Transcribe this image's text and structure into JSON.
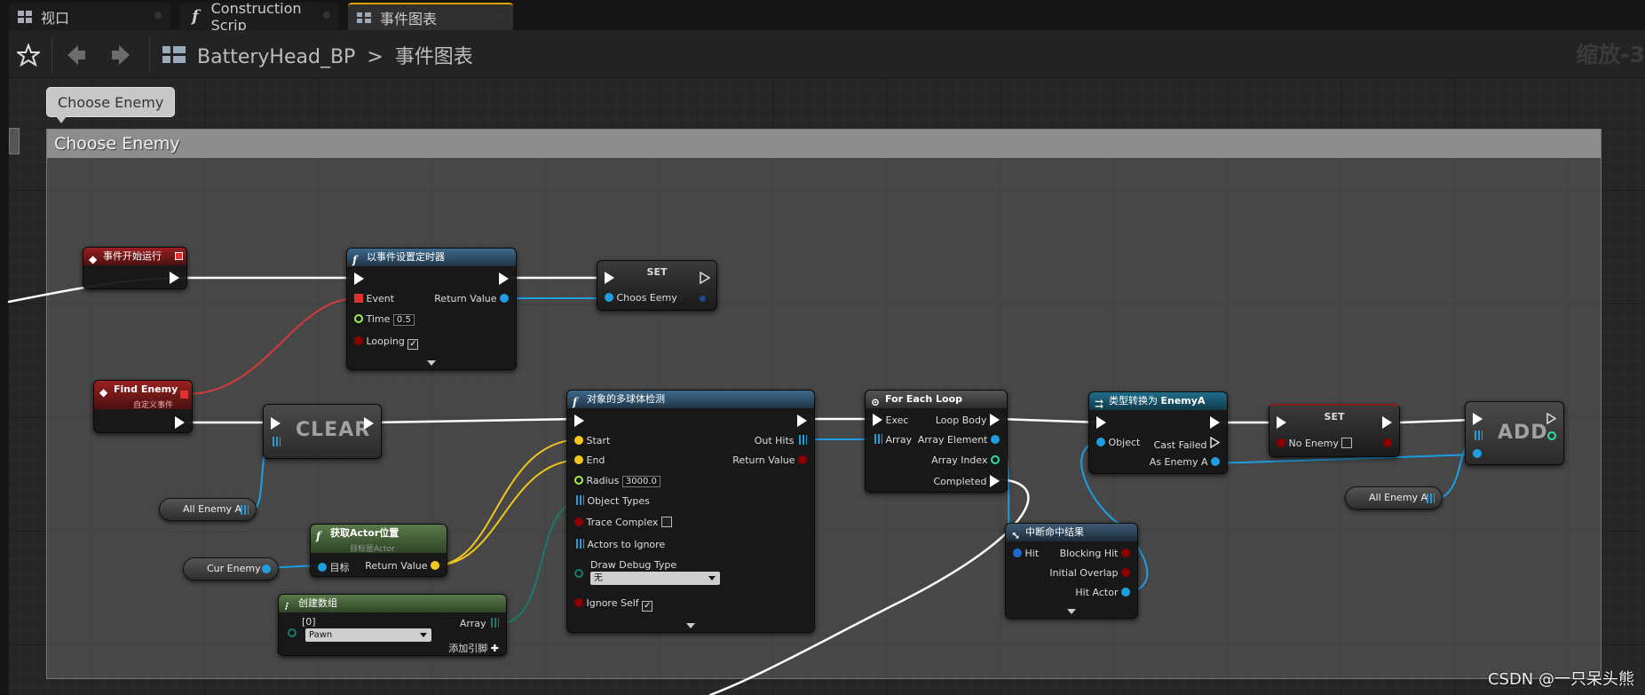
{
  "tabs": [
    {
      "label": "视口",
      "icon": "viewport-icon"
    },
    {
      "label": "Construction Scrip",
      "icon": "function-icon"
    },
    {
      "label": "事件图表",
      "icon": "event-graph-icon"
    }
  ],
  "toolbar": {
    "blueprint": "BatteryHead_BP",
    "separator": ">",
    "graph": "事件图表",
    "zoom": "缩放-3"
  },
  "bubble": "Choose Enemy",
  "comment": "Choose Enemy",
  "nodes": {
    "begin_play": {
      "title": "事件开始运行"
    },
    "timer": {
      "title": "以事件设置定时器",
      "event": "Event",
      "time": "Time",
      "time_val": "0.5",
      "looping": "Looping",
      "return": "Return Value",
      "looping_checked": "✓"
    },
    "set1": {
      "title": "SET",
      "var": "Choos Eemy"
    },
    "find_enemy": {
      "title": "Find Enemy",
      "sub": "自定义事件"
    },
    "clear": {
      "title": "CLEAR"
    },
    "all_enemy_a1": {
      "label": "All Enemy A"
    },
    "cur_enemy": {
      "label": "Cur Enemy"
    },
    "get_loc": {
      "title": "获取Actor位置",
      "sub": "目标是Actor",
      "target": "目标",
      "ret": "Return Value"
    },
    "make_array": {
      "title": "创建数组",
      "idx": "[0]",
      "val": "Pawn",
      "out": "Array",
      "add": "添加引脚"
    },
    "sphere": {
      "title": "对象的多球体检测",
      "start": "Start",
      "end": "End",
      "radius": "Radius",
      "radius_val": "3000.0",
      "obj_types": "Object Types",
      "trace_complex": "Trace Complex",
      "ignore": "Actors to Ignore",
      "debug": "Draw Debug Type",
      "debug_val": "无",
      "ignore_self": "Ignore Self",
      "out_hits": "Out Hits",
      "ret": "Return Value",
      "ignore_self_checked": "✓"
    },
    "foreach": {
      "title": "For Each Loop",
      "exec": "Exec",
      "array": "Array",
      "body": "Loop Body",
      "elem": "Array Element",
      "index": "Array Index",
      "done": "Completed"
    },
    "break_hit": {
      "title": "中断命中结果",
      "hit": "Hit",
      "blocking": "Blocking Hit",
      "overlap": "Initial Overlap",
      "actor": "Hit Actor"
    },
    "cast": {
      "title": "类型转换为 ",
      "title_bold": "EnemyA",
      "object": "Object",
      "failed": "Cast Failed",
      "as": "As Enemy A"
    },
    "set2": {
      "title": "SET",
      "var": "No Enemy"
    },
    "add": {
      "title": "ADD"
    },
    "all_enemy_a2": {
      "label": "All Enemy A"
    }
  },
  "watermark": "CSDN @一只呆头熊",
  "colors": {
    "exec": "#ffffff",
    "object": "#1e9ee0",
    "vector": "#f2c71b",
    "bool": "#8c0000",
    "float": "#a0f050",
    "delegate": "#e03030",
    "array_obj": "#1e9ee0",
    "array_enum": "#1a7a6a"
  }
}
